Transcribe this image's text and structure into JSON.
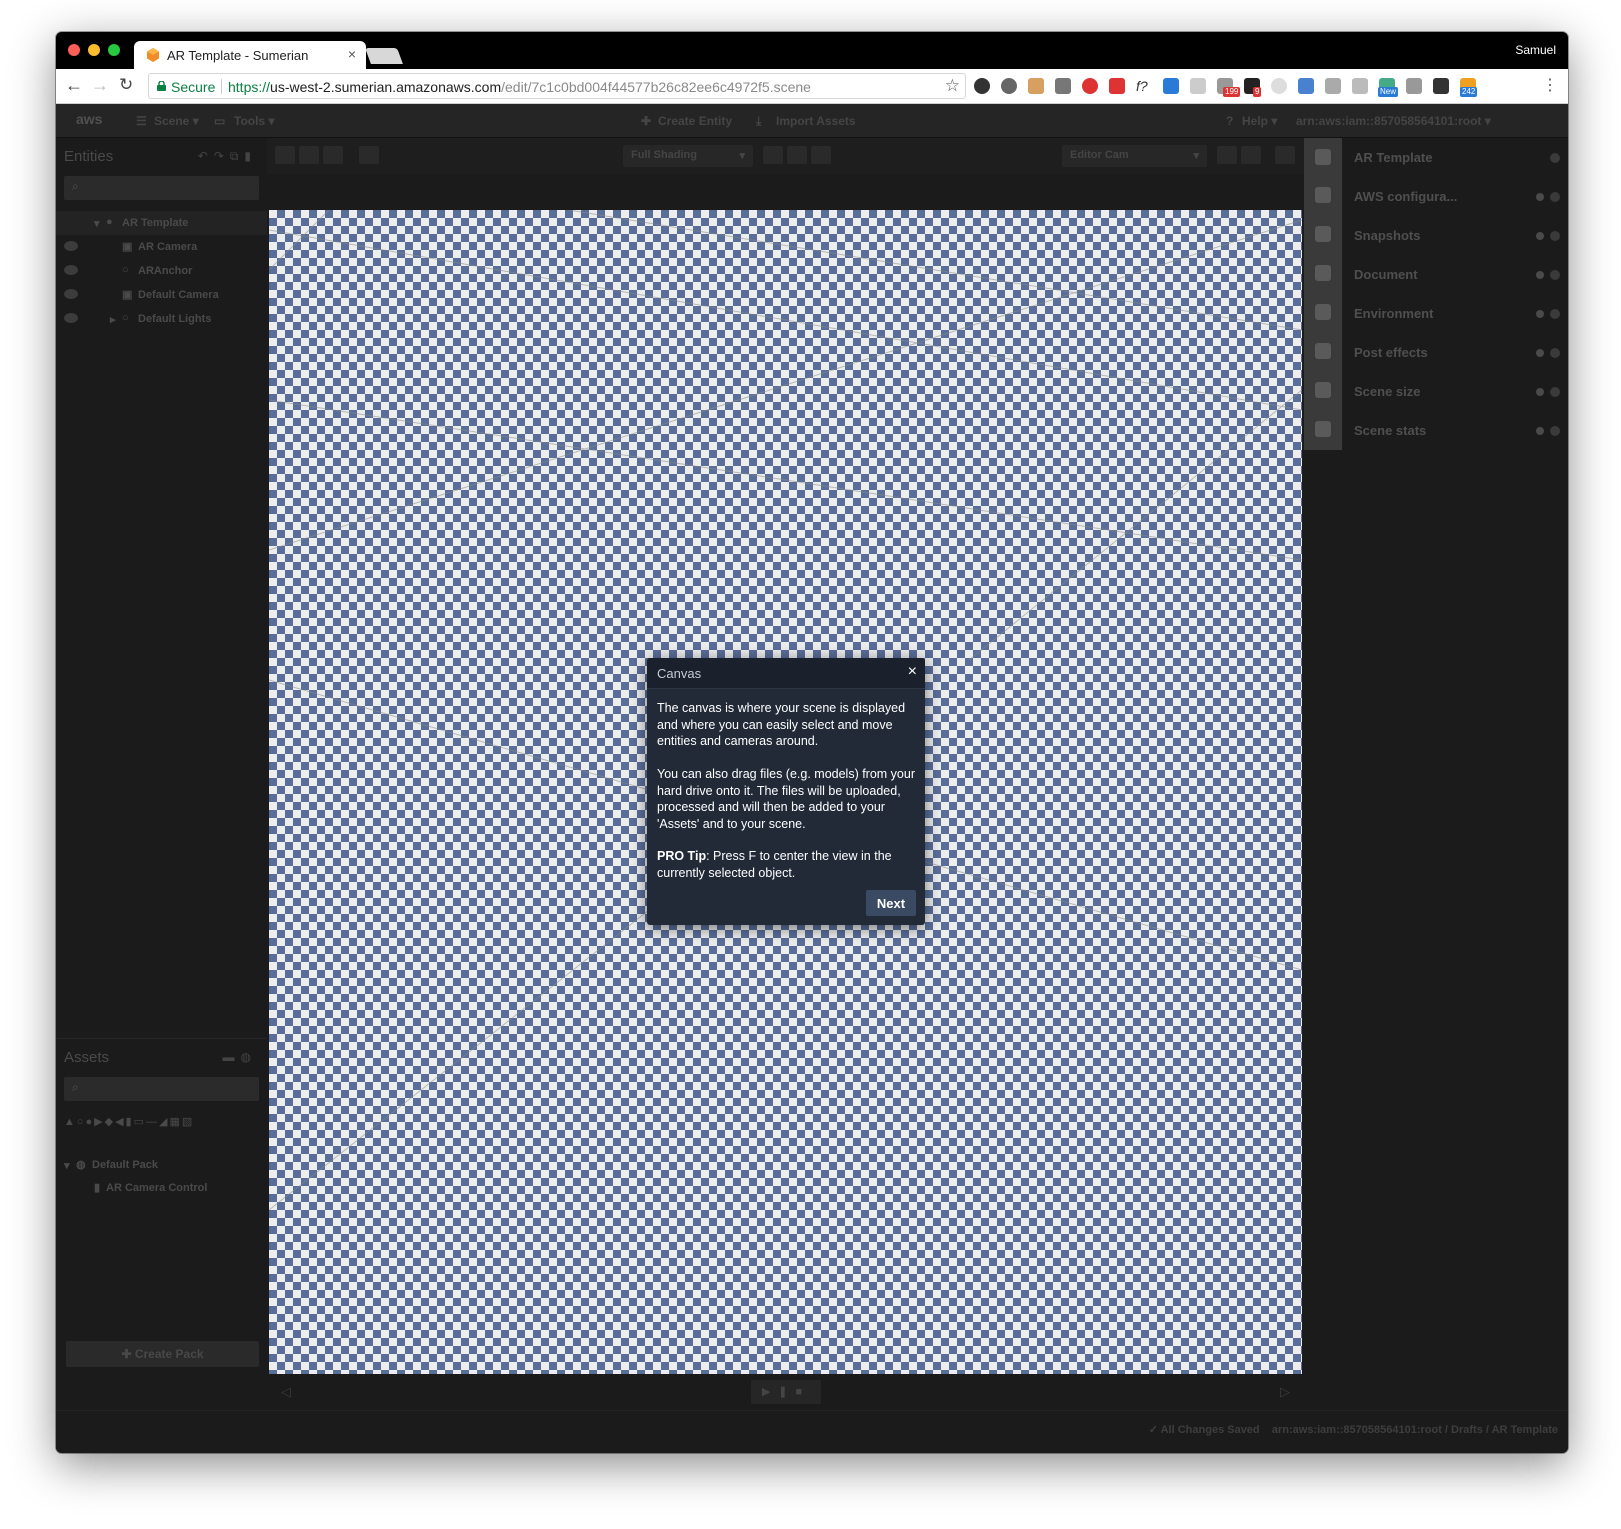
{
  "browser": {
    "tab_title": "AR Template - Sumerian",
    "tab_close": "×",
    "profile_name": "Samuel",
    "secure_label": "Secure",
    "url_scheme": "https://",
    "url_host": "us-west-2.sumerian.amazonaws.com",
    "url_path": "/edit/7c1c0bd004f44577b26c82ee6c4972f5.scene",
    "extension_badges": [
      "199",
      "9",
      "New",
      "242"
    ]
  },
  "app": {
    "logo": "aws",
    "menus": [
      "Scene ▾",
      "Tools ▾"
    ],
    "actions": [
      "Create Entity",
      "Import Assets"
    ],
    "help_label": "Help ▾",
    "account_label": "arn:aws:iam::857058564101:root ▾",
    "entities": {
      "title": "Entities",
      "items": [
        {
          "label": "AR Template"
        },
        {
          "label": "AR Camera"
        },
        {
          "label": "ARAnchor"
        },
        {
          "label": "Default Camera"
        },
        {
          "label": "Default Lights"
        }
      ]
    },
    "assets": {
      "title": "Assets",
      "pack": "Default Pack",
      "items": [
        {
          "label": "AR Camera Control"
        }
      ],
      "create_pack_label": "Create Pack"
    },
    "viewport": {
      "shading_select": "Full Shading",
      "camera_select": "Editor Cam"
    },
    "inspector": {
      "items": [
        {
          "label": "AR Template"
        },
        {
          "label": "AWS configura..."
        },
        {
          "label": "Snapshots"
        },
        {
          "label": "Document"
        },
        {
          "label": "Environment"
        },
        {
          "label": "Post effects"
        },
        {
          "label": "Scene size"
        },
        {
          "label": "Scene stats"
        }
      ]
    },
    "status": {
      "saved": "✓ All Changes Saved",
      "path": "arn:aws:iam::857058564101:root / Drafts / AR Template"
    }
  },
  "dialog": {
    "title": "Canvas",
    "close": "×",
    "p1": "The canvas is where your scene is displayed and where you can easily select and move entities and cameras around.",
    "p2": "You can also drag files (e.g. models) from your hard drive onto it. The files will be uploaded, processed and will then be added to your 'Assets' and to your scene.",
    "p3_bold": "PRO Tip",
    "p3_rest": ": Press F to center the view in the currently selected object.",
    "next_label": "Next"
  }
}
